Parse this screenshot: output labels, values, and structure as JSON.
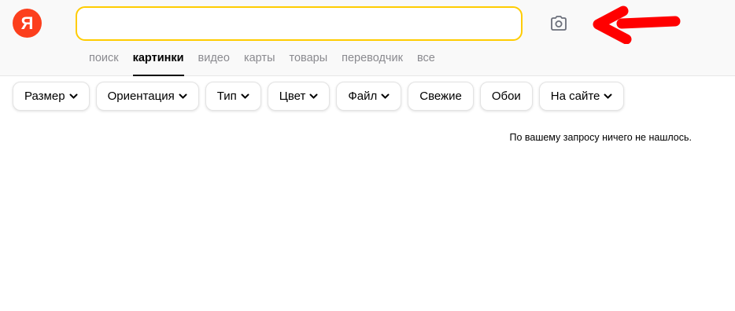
{
  "logo": {
    "letter": "Я",
    "color": "#fc3f1d"
  },
  "search": {
    "value": "",
    "placeholder": "",
    "border_color": "#ffcc00"
  },
  "camera_button": {
    "icon": "camera-icon"
  },
  "annotation": {
    "icon": "red-arrow",
    "color": "#ff0000"
  },
  "nav": {
    "items": [
      {
        "label": "поиск",
        "active": false
      },
      {
        "label": "картинки",
        "active": true
      },
      {
        "label": "видео",
        "active": false
      },
      {
        "label": "карты",
        "active": false
      },
      {
        "label": "товары",
        "active": false
      },
      {
        "label": "переводчик",
        "active": false
      },
      {
        "label": "все",
        "active": false
      }
    ]
  },
  "filters": {
    "items": [
      {
        "label": "Размер",
        "dropdown": true
      },
      {
        "label": "Ориентация",
        "dropdown": true
      },
      {
        "label": "Тип",
        "dropdown": true
      },
      {
        "label": "Цвет",
        "dropdown": true
      },
      {
        "label": "Файл",
        "dropdown": true
      },
      {
        "label": "Свежие",
        "dropdown": false
      },
      {
        "label": "Обои",
        "dropdown": false
      },
      {
        "label": "На сайте",
        "dropdown": true
      }
    ]
  },
  "results": {
    "empty_message": "По вашему запросу ничего не нашлось."
  }
}
